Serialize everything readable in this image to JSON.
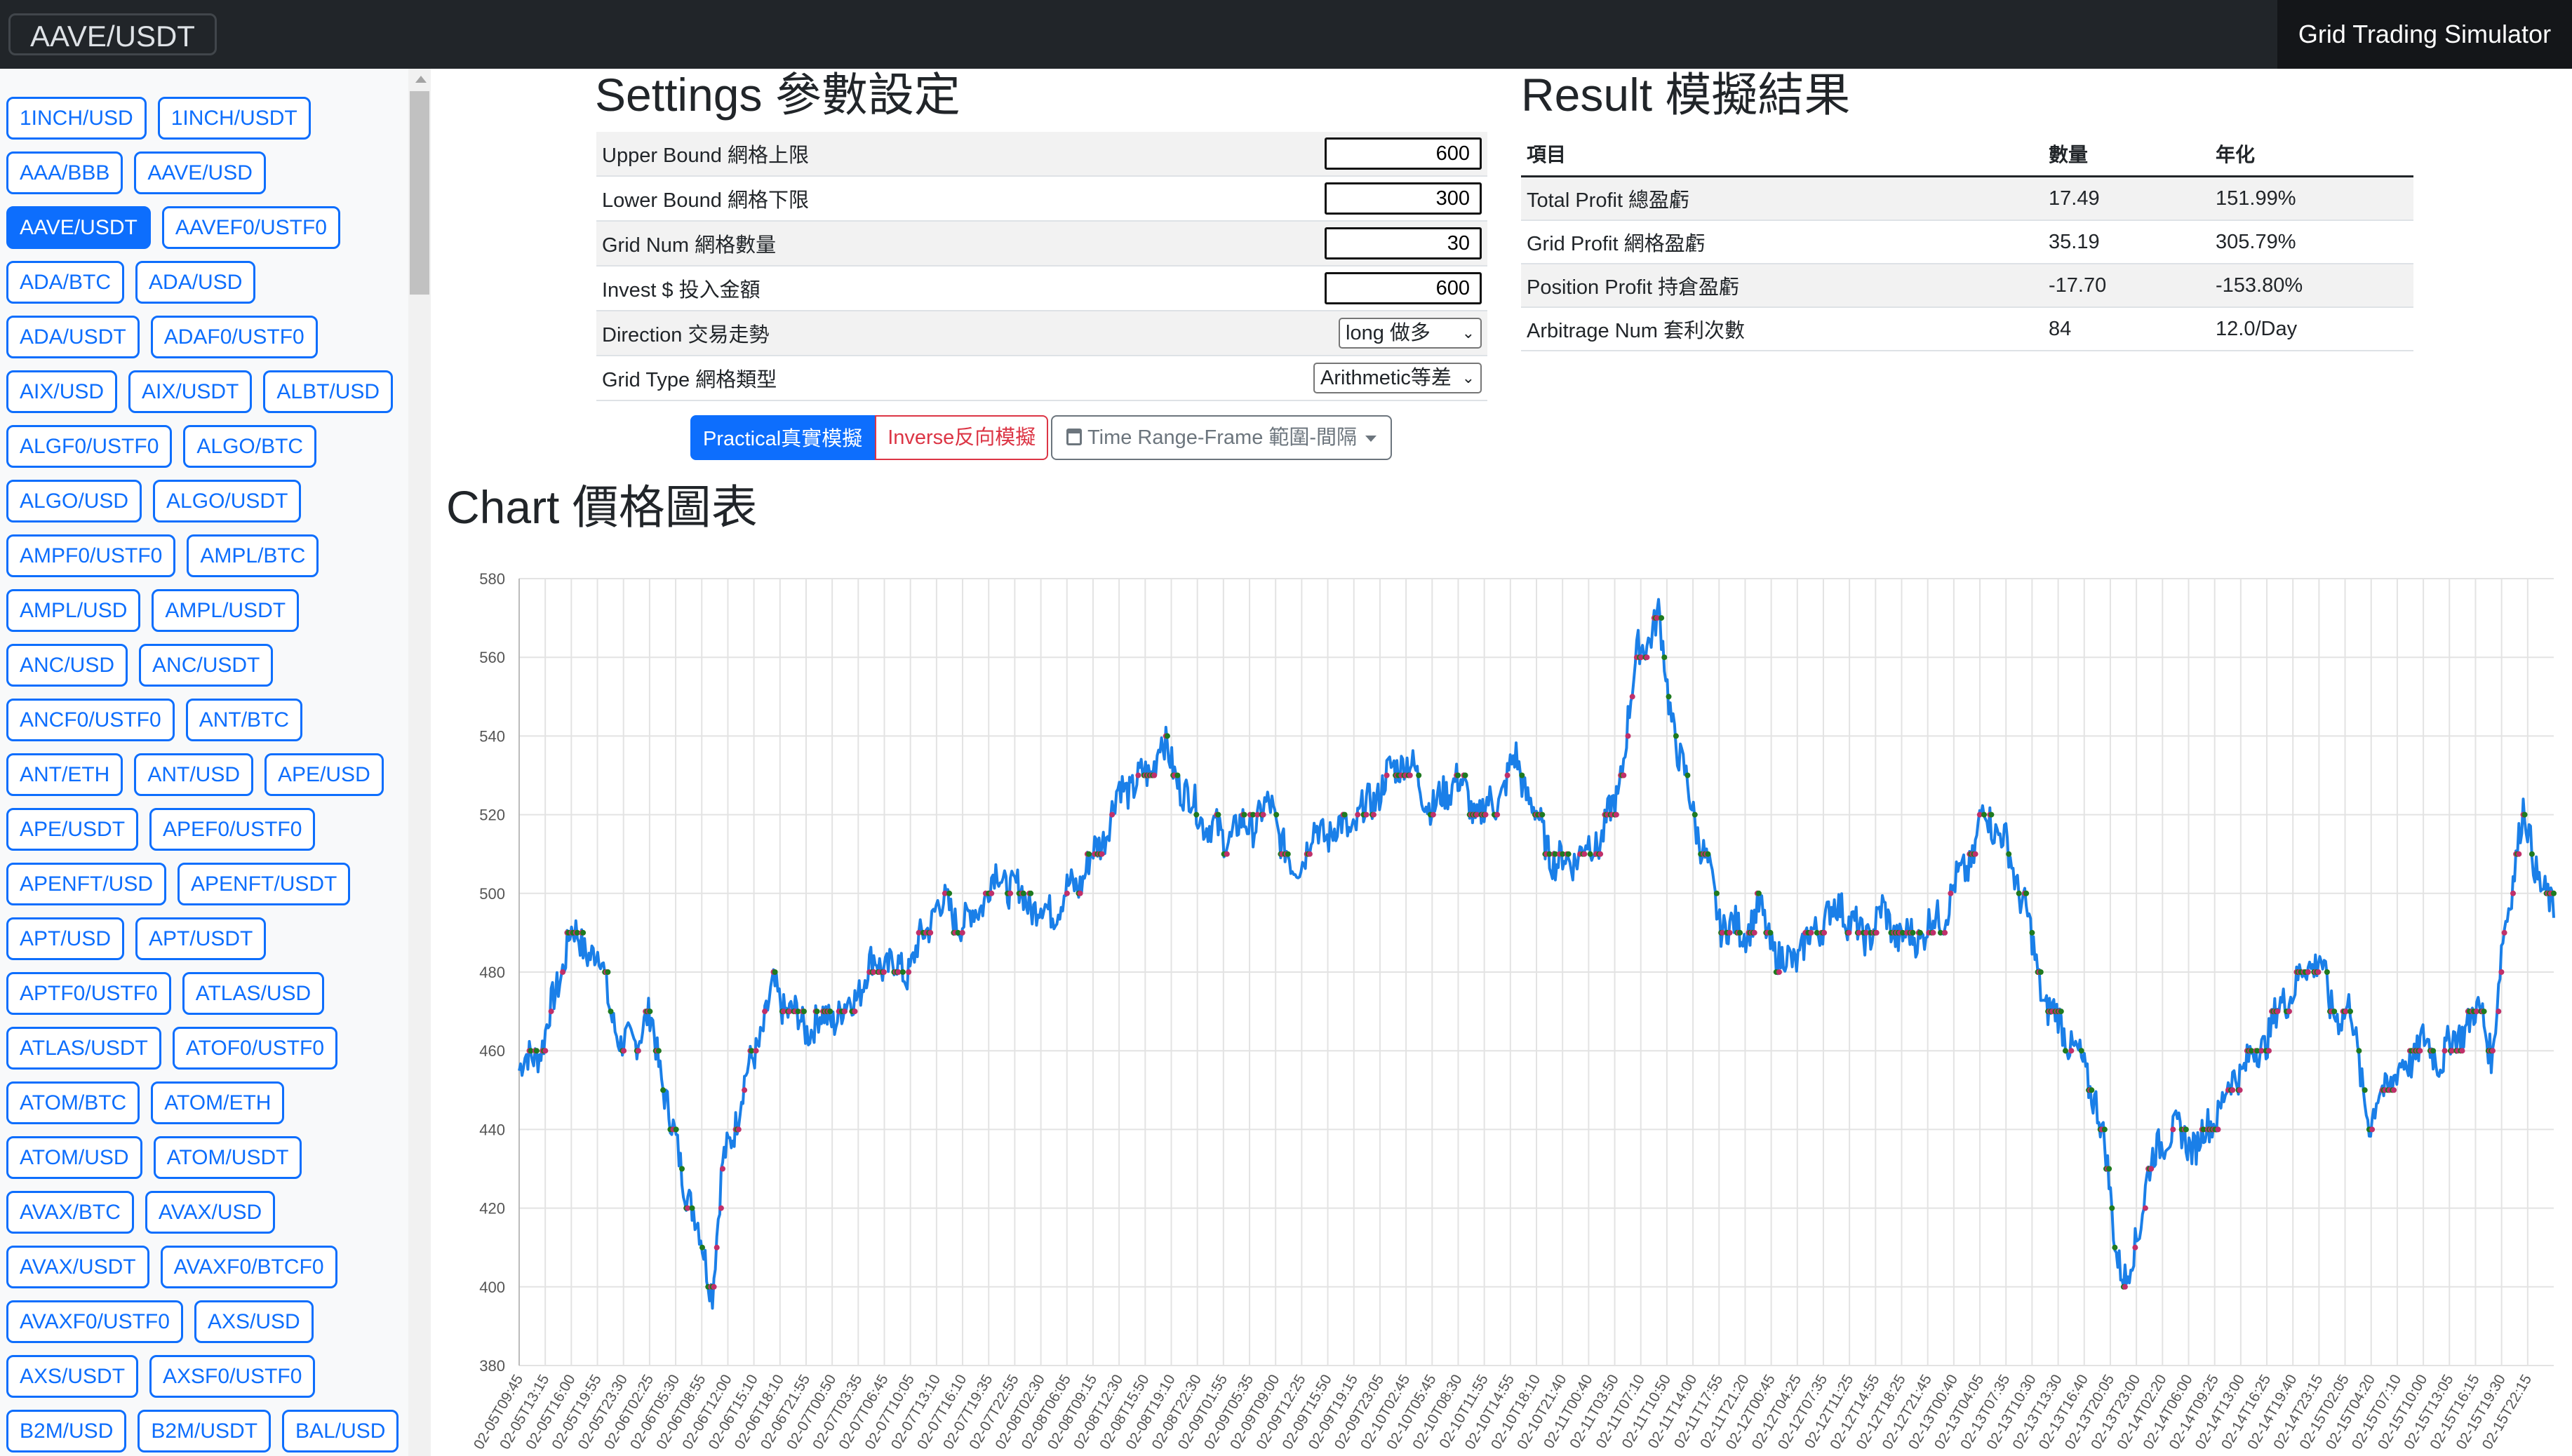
{
  "navbar": {
    "pair": "AAVE/USDT",
    "app_title": "Grid Trading Simulator"
  },
  "sidebar": {
    "pairs": [
      "1INCH/USD",
      "1INCH/USDT",
      "AAA/BBB",
      "AAVE/USD",
      "AAVE/USDT",
      "AAVEF0/USTF0",
      "ADA/BTC",
      "ADA/USD",
      "ADA/USDT",
      "ADAF0/USTF0",
      "AIX/USD",
      "AIX/USDT",
      "ALBT/USD",
      "ALGF0/USTF0",
      "ALGO/BTC",
      "ALGO/USD",
      "ALGO/USDT",
      "AMPF0/USTF0",
      "AMPL/BTC",
      "AMPL/USD",
      "AMPL/USDT",
      "ANC/USD",
      "ANC/USDT",
      "ANCF0/USTF0",
      "ANT/BTC",
      "ANT/ETH",
      "ANT/USD",
      "APE/USD",
      "APE/USDT",
      "APEF0/USTF0",
      "APENFT/USD",
      "APENFT/USDT",
      "APT/USD",
      "APT/USDT",
      "APTF0/USTF0",
      "ATLAS/USD",
      "ATLAS/USDT",
      "ATOF0/USTF0",
      "ATOM/BTC",
      "ATOM/ETH",
      "ATOM/USD",
      "ATOM/USDT",
      "AVAX/BTC",
      "AVAX/USD",
      "AVAX/USDT",
      "AVAXF0/BTCF0",
      "AVAXF0/USTF0",
      "AXS/USD",
      "AXS/USDT",
      "AXSF0/USTF0",
      "B2M/USD",
      "B2M/USDT",
      "BAL/USD"
    ],
    "active_pair": "AAVE/USDT"
  },
  "settings": {
    "title": "Settings 參數設定",
    "upper_bound": {
      "label": "Upper Bound 網格上限",
      "value": "600"
    },
    "lower_bound": {
      "label": "Lower Bound 網格下限",
      "value": "300"
    },
    "grid_num": {
      "label": "Grid Num 網格數量",
      "value": "30"
    },
    "invest": {
      "label": "Invest $ 投入金額",
      "value": "600"
    },
    "direction": {
      "label": "Direction 交易走勢",
      "value": "long 做多"
    },
    "grid_type": {
      "label": "Grid Type 網格類型",
      "value": "Arithmetic等差"
    },
    "practical_label": "Practical真實模擬",
    "inverse_label": "Inverse反向模擬",
    "time_range_label": "Time Range-Frame 範圍-間隔"
  },
  "result": {
    "title": "Result 模擬結果",
    "headers": [
      "項目",
      "數量",
      "年化"
    ],
    "rows": [
      [
        "Total Profit 總盈虧",
        "17.49",
        "151.99%"
      ],
      [
        "Grid Profit 網格盈虧",
        "35.19",
        "305.79%"
      ],
      [
        "Position Profit 持倉盈虧",
        "-17.70",
        "-153.80%"
      ],
      [
        "Arbitrage Num 套利次數",
        "84",
        "12.0/Day"
      ]
    ]
  },
  "chart_title": "Chart 價格圖表",
  "colors": {
    "primary": "#0d6efd",
    "danger": "#dc3545",
    "line": "#1a7fe8",
    "buy": "#1f7a1f",
    "sell": "#c0306a"
  },
  "chart_data": {
    "type": "line",
    "ylim": [
      380,
      580
    ],
    "y_ticks": [
      380,
      400,
      420,
      440,
      460,
      480,
      500,
      520,
      540,
      560,
      580
    ],
    "x_labels": [
      "02-05T09:45",
      "02-05T13:15",
      "02-05T16:00",
      "02-05T19:55",
      "02-05T23:30",
      "02-06T02:25",
      "02-06T05:30",
      "02-06T08:55",
      "02-06T12:00",
      "02-06T15:10",
      "02-06T18:10",
      "02-06T21:55",
      "02-07T00:50",
      "02-07T03:35",
      "02-07T06:45",
      "02-07T10:05",
      "02-07T13:10",
      "02-07T16:10",
      "02-07T19:35",
      "02-07T22:55",
      "02-08T02:30",
      "02-08T06:05",
      "02-08T09:15",
      "02-08T12:30",
      "02-08T15:50",
      "02-08T19:10",
      "02-08T22:30",
      "02-09T01:55",
      "02-09T05:35",
      "02-09T09:00",
      "02-09T12:25",
      "02-09T15:50",
      "02-09T19:15",
      "02-09T23:05",
      "02-10T02:45",
      "02-10T05:45",
      "02-10T08:30",
      "02-10T11:55",
      "02-10T14:55",
      "02-10T18:10",
      "02-10T21:40",
      "02-11T00:40",
      "02-11T03:50",
      "02-11T07:10",
      "02-11T10:50",
      "02-11T14:00",
      "02-11T17:55",
      "02-11T21:20",
      "02-12T00:45",
      "02-12T04:25",
      "02-12T07:35",
      "02-12T11:25",
      "02-12T14:55",
      "02-12T18:25",
      "02-12T21:45",
      "02-13T00:40",
      "02-13T04:05",
      "02-13T07:35",
      "02-13T10:30",
      "02-13T13:30",
      "02-13T16:40",
      "02-13T20:05",
      "02-13T23:00",
      "02-14T02:20",
      "02-14T06:00",
      "02-14T09:25",
      "02-14T13:00",
      "02-14T16:25",
      "02-14T19:40",
      "02-14T23:15",
      "02-15T02:05",
      "02-15T04:20",
      "02-15T07:10",
      "02-15T10:00",
      "02-15T13:05",
      "02-15T16:15",
      "02-15T19:30",
      "02-15T22:15"
    ],
    "anchors": [
      [
        0,
        455
      ],
      [
        0.012,
        462
      ],
      [
        0.025,
        490
      ],
      [
        0.04,
        483
      ],
      [
        0.05,
        460
      ],
      [
        0.065,
        468
      ],
      [
        0.075,
        440
      ],
      [
        0.085,
        420
      ],
      [
        0.095,
        400
      ],
      [
        0.1,
        430
      ],
      [
        0.11,
        450
      ],
      [
        0.125,
        475
      ],
      [
        0.14,
        466
      ],
      [
        0.16,
        470
      ],
      [
        0.175,
        483
      ],
      [
        0.19,
        480
      ],
      [
        0.2,
        490
      ],
      [
        0.205,
        498
      ],
      [
        0.22,
        492
      ],
      [
        0.235,
        505
      ],
      [
        0.25,
        498
      ],
      [
        0.26,
        495
      ],
      [
        0.275,
        503
      ],
      [
        0.285,
        512
      ],
      [
        0.295,
        526
      ],
      [
        0.31,
        530
      ],
      [
        0.315,
        540
      ],
      [
        0.32,
        533
      ],
      [
        0.33,
        523
      ],
      [
        0.345,
        514
      ],
      [
        0.36,
        518
      ],
      [
        0.37,
        522
      ],
      [
        0.38,
        505
      ],
      [
        0.39,
        515
      ],
      [
        0.41,
        517
      ],
      [
        0.425,
        528
      ],
      [
        0.435,
        535
      ],
      [
        0.44,
        530
      ],
      [
        0.45,
        521
      ],
      [
        0.46,
        530
      ],
      [
        0.47,
        520
      ],
      [
        0.48,
        523
      ],
      [
        0.49,
        534
      ],
      [
        0.5,
        519
      ],
      [
        0.51,
        507
      ],
      [
        0.52,
        510
      ],
      [
        0.53,
        513
      ],
      [
        0.54,
        524
      ],
      [
        0.545,
        545
      ],
      [
        0.55,
        561
      ],
      [
        0.56,
        570
      ],
      [
        0.565,
        550
      ],
      [
        0.57,
        535
      ],
      [
        0.58,
        515
      ],
      [
        0.59,
        493
      ],
      [
        0.6,
        490
      ],
      [
        0.61,
        495
      ],
      [
        0.62,
        482
      ],
      [
        0.63,
        485
      ],
      [
        0.64,
        493
      ],
      [
        0.65,
        497
      ],
      [
        0.66,
        488
      ],
      [
        0.67,
        495
      ],
      [
        0.68,
        488
      ],
      [
        0.69,
        490
      ],
      [
        0.7,
        495
      ],
      [
        0.71,
        506
      ],
      [
        0.715,
        510
      ],
      [
        0.72,
        522
      ],
      [
        0.73,
        513
      ],
      [
        0.74,
        497
      ],
      [
        0.745,
        483
      ],
      [
        0.75,
        472
      ],
      [
        0.76,
        465
      ],
      [
        0.775,
        448
      ],
      [
        0.78,
        432
      ],
      [
        0.785,
        410
      ],
      [
        0.79,
        400
      ],
      [
        0.795,
        412
      ],
      [
        0.8,
        428
      ],
      [
        0.81,
        440
      ],
      [
        0.825,
        436
      ],
      [
        0.835,
        445
      ],
      [
        0.845,
        455
      ],
      [
        0.855,
        460
      ],
      [
        0.87,
        475
      ],
      [
        0.885,
        485
      ],
      [
        0.89,
        470
      ],
      [
        0.9,
        470
      ],
      [
        0.905,
        455
      ],
      [
        0.91,
        440
      ],
      [
        0.915,
        450
      ],
      [
        0.925,
        455
      ],
      [
        0.935,
        462
      ],
      [
        0.945,
        458
      ],
      [
        0.955,
        466
      ],
      [
        0.965,
        470
      ],
      [
        0.97,
        458
      ],
      [
        0.975,
        488
      ],
      [
        0.98,
        505
      ],
      [
        0.985,
        520
      ],
      [
        0.99,
        510
      ],
      [
        0.995,
        500
      ],
      [
        1.0,
        494
      ]
    ]
  }
}
